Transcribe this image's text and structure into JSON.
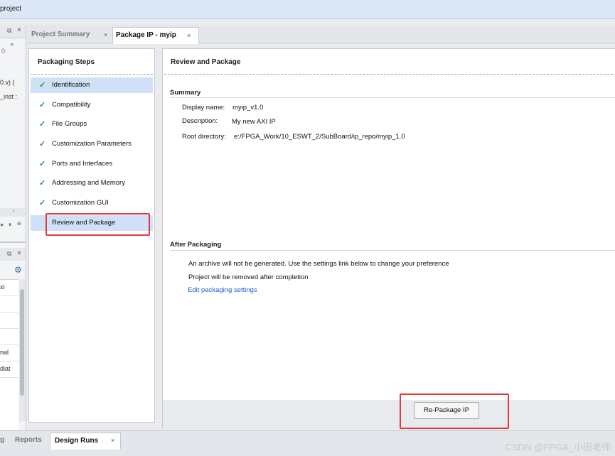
{
  "window": {
    "title": "project"
  },
  "left_panel": {
    "ellipsis": "»",
    "zero": "0",
    "file_fragment": "0.v) (",
    "inst_fragment": "_inst :",
    "items": [
      "xi",
      "nal",
      "diat"
    ]
  },
  "tabs": [
    {
      "label": "Project Summary",
      "active": false
    },
    {
      "label": "Package IP - myip",
      "active": true
    }
  ],
  "close_glyph": "×",
  "check_glyph": "✓",
  "packaging_steps": {
    "title": "Packaging Steps",
    "items": [
      {
        "label": "Identification",
        "checked": true,
        "selected": true
      },
      {
        "label": "Compatibility",
        "checked": true
      },
      {
        "label": "File Groups",
        "checked": true
      },
      {
        "label": "Customization Parameters",
        "checked": true
      },
      {
        "label": "Ports and Interfaces",
        "checked": true
      },
      {
        "label": "Addressing and Memory",
        "checked": true
      },
      {
        "label": "Customization GUI",
        "checked": true
      },
      {
        "label": "Review and Package",
        "checked": false,
        "highlighted": true
      }
    ]
  },
  "review": {
    "title": "Review and Package",
    "summary_heading": "Summary",
    "display_name_label": "Display name:",
    "display_name_value": "myip_v1.0",
    "description_label": "Description:",
    "description_value": "My new AXI IP",
    "root_label": "Root directory:",
    "root_value": "e:/FPGA_Work/10_ESWT_2/SubBoard/ip_repo/myip_1.0",
    "after_heading": "After Packaging",
    "after_line1": "An archive will not be generated. Use the settings link below to change your preference",
    "after_line2": "Project will be removed after completion",
    "edit_link": "Edit packaging settings",
    "repackage_button": "Re-Package IP"
  },
  "bottom_tabs": [
    {
      "label": "g",
      "active": false
    },
    {
      "label": "Reports",
      "active": false
    },
    {
      "label": "Design Runs",
      "active": true
    }
  ],
  "watermark": "CSDN @FPGA_小田老师",
  "colors": {
    "accent_check": "#2a9a3a",
    "selection": "#cfe0f7",
    "highlight_box": "#e23a3a",
    "link": "#1f5fc8"
  }
}
